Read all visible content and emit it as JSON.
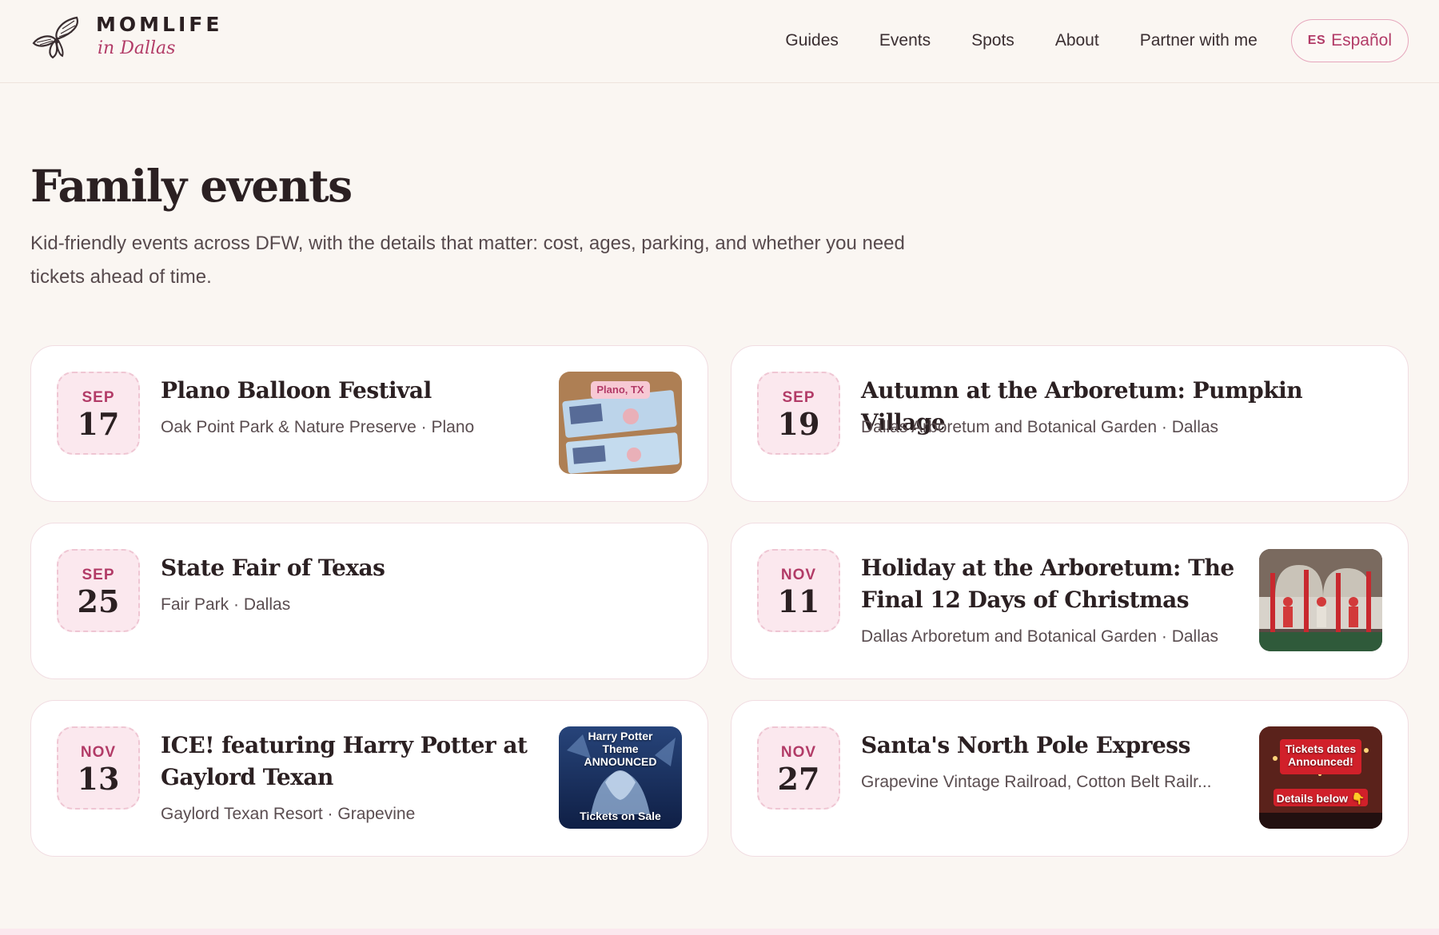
{
  "brand": {
    "name": "MOMLIFE",
    "tagline": "in Dallas"
  },
  "nav": {
    "items": [
      "Guides",
      "Events",
      "Spots",
      "About",
      "Partner with me"
    ],
    "lang_code": "ES",
    "lang_label": "Español"
  },
  "hero": {
    "title": "Family events",
    "subtitle": "Kid-friendly events across DFW, with the details that matter: cost, ages, parking, and whether you need tickets ahead of time."
  },
  "events": [
    {
      "month": "SEP",
      "day": "17",
      "title": "Plano Balloon Festival",
      "venue": "Oak Point Park & Nature Preserve · Plano",
      "thumb_text": "Plano, TX"
    },
    {
      "month": "SEP",
      "day": "19",
      "title": "Autumn at the Arboretum: Pumpkin Village",
      "venue": "Dallas Arboretum and Botanical Garden · Dallas"
    },
    {
      "month": "SEP",
      "day": "25",
      "title": "State Fair of Texas",
      "venue": "Fair Park · Dallas"
    },
    {
      "month": "NOV",
      "day": "11",
      "title": "Holiday at the Arboretum: The Final 12 Days of Christmas",
      "venue": "Dallas Arboretum and Botanical Garden · Dallas"
    },
    {
      "month": "NOV",
      "day": "13",
      "title": "ICE! featuring Harry Potter at Gaylord Texan",
      "venue": "Gaylord Texan Resort · Grapevine",
      "thumb_text_top": "Harry Potter Theme ANNOUNCED",
      "thumb_text_bottom": "Tickets on Sale"
    },
    {
      "month": "NOV",
      "day": "27",
      "title": "Santa's North Pole Express",
      "venue": "Grapevine Vintage Railroad, Cotton Belt Railr...",
      "thumb_text_top": "Tickets dates Announced!",
      "thumb_text_bottom": "Details below 👇"
    }
  ],
  "colors": {
    "accent": "#b23b67",
    "background": "#faf6f2",
    "date_bg": "#fbe8ee",
    "card_border": "#f1dde2"
  },
  "icons": {
    "logo": "butterfly-icon"
  }
}
